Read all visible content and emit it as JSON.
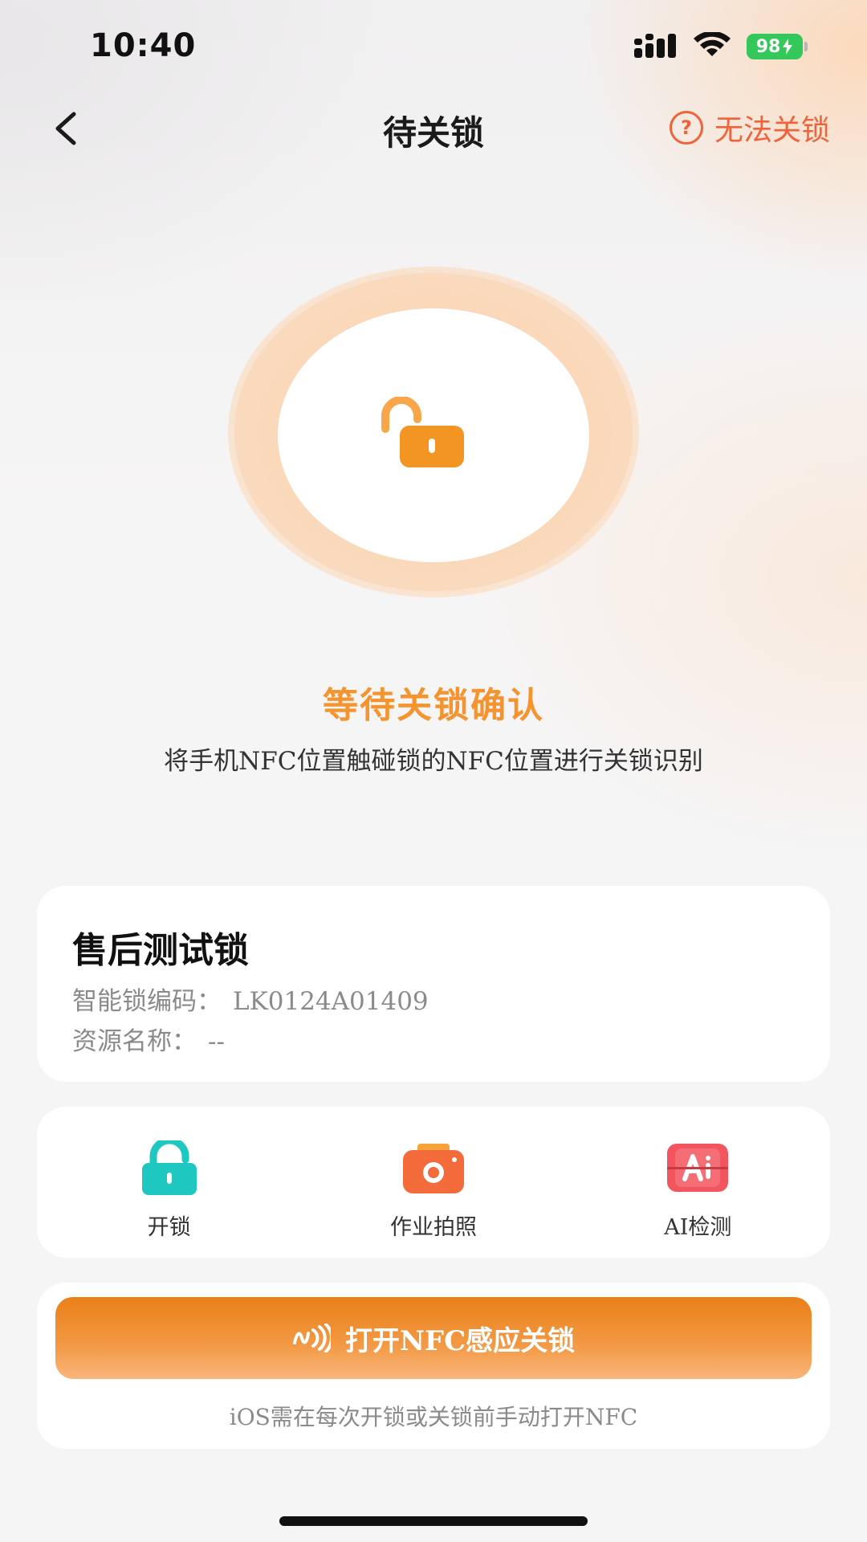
{
  "status_bar": {
    "time": "10:40",
    "battery": "98"
  },
  "nav": {
    "title": "待关锁",
    "help_label": "无法关锁",
    "help_glyph": "?"
  },
  "hero": {
    "status_title": "等待关锁确认",
    "status_desc": "将手机NFC位置触碰锁的NFC位置进行关锁识别",
    "icon": "unlocked-padlock-icon",
    "accent_color": "#f5932f"
  },
  "lock_info": {
    "name": "售后测试锁",
    "code_label": "智能锁编码：",
    "code_value": "LK0124A01409",
    "resource_label": "资源名称：",
    "resource_value": "--"
  },
  "actions": [
    {
      "label": "开锁",
      "icon": "unlock-icon",
      "color": "#1ec8c0"
    },
    {
      "label": "作业拍照",
      "icon": "camera-icon",
      "color": "#f36b3b"
    },
    {
      "label": "AI检测",
      "icon": "ai-scan-icon",
      "color": "#f2555e"
    }
  ],
  "nfc": {
    "button_label": "打开NFC感应关锁",
    "hint": "iOS需在每次开锁或关锁前手动打开NFC",
    "icon": "nfc-icon"
  }
}
